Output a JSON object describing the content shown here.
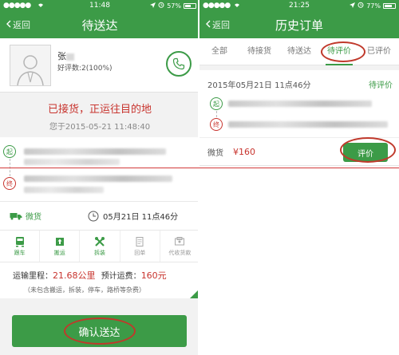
{
  "left": {
    "status": {
      "carrier": "",
      "time": "11:48",
      "battery": "57%",
      "battery_level": 0.57
    },
    "nav": {
      "back": "返回",
      "title": "待送达"
    },
    "driver": {
      "name": "张",
      "rating": "好评数:2(100%)"
    },
    "status_text": "已接货，正运往目的地",
    "status_time": "您于2015-05-21 11:48:40",
    "route": {
      "start_label": "起",
      "end_label": "终"
    },
    "cargo": "微货",
    "datetime": "05月21日 11点46分",
    "services": [
      {
        "label": "跟车",
        "icon": "car-follow-icon",
        "active": true
      },
      {
        "label": "搬运",
        "icon": "carry-icon",
        "active": true
      },
      {
        "label": "拆装",
        "icon": "tools-icon",
        "active": true
      },
      {
        "label": "回单",
        "icon": "receipt-icon",
        "active": false
      },
      {
        "label": "代收货款",
        "icon": "collect-payment-icon",
        "active": false
      }
    ],
    "fee": {
      "distance_label": "运输里程：",
      "distance_value": "21.68公里",
      "fee_label": "预计运费：",
      "fee_value": "160元",
      "note": "（未包含搬运，拆装，停车，路桥等杂费）"
    },
    "confirm_button": "确认送达"
  },
  "right": {
    "status": {
      "time": "21:25",
      "battery": "77%",
      "battery_level": 0.77
    },
    "nav": {
      "back": "返回",
      "title": "历史订单"
    },
    "tabs": [
      {
        "label": "全部",
        "active": false
      },
      {
        "label": "待接货",
        "active": false
      },
      {
        "label": "待送达",
        "active": false
      },
      {
        "label": "待评价",
        "active": true
      },
      {
        "label": "已评价",
        "active": false
      }
    ],
    "order": {
      "date": "2015年05月21日 11点46分",
      "status": "待评价",
      "start_label": "起",
      "end_label": "终",
      "cargo": "微货",
      "price": "¥160",
      "rate_button": "评价"
    }
  },
  "colors": {
    "brand_green": "#3c9b47",
    "alert_red": "#c8342e"
  }
}
